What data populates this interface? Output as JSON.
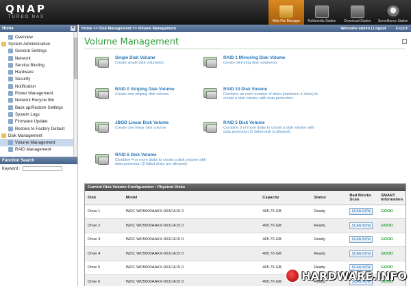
{
  "header": {
    "brand": "QNAP",
    "model": "TURBO NAS",
    "nav": [
      {
        "label": "Web File Manager",
        "icon": "folder-icon"
      },
      {
        "label": "Multimedia Station",
        "icon": "multimedia-icon"
      },
      {
        "label": "Download Station",
        "icon": "download-icon"
      },
      {
        "label": "Surveillance Station",
        "icon": "camera-icon"
      }
    ]
  },
  "sidebar": {
    "title": "Home",
    "close": "×",
    "items": [
      {
        "label": "Overview",
        "level": 2
      },
      {
        "label": "System Administration",
        "level": 1
      },
      {
        "label": "General Settings",
        "level": 2
      },
      {
        "label": "Network",
        "level": 2
      },
      {
        "label": "Service Binding",
        "level": 2
      },
      {
        "label": "Hardware",
        "level": 2
      },
      {
        "label": "Security",
        "level": 2
      },
      {
        "label": "Notification",
        "level": 2
      },
      {
        "label": "Power Management",
        "level": 2
      },
      {
        "label": "Network Recycle Bin",
        "level": 2
      },
      {
        "label": "Back up/Restore Settings",
        "level": 2
      },
      {
        "label": "System Logs",
        "level": 2
      },
      {
        "label": "Firmware Update",
        "level": 2
      },
      {
        "label": "Restore to Factory Default",
        "level": 2
      },
      {
        "label": "Disk Management",
        "level": 1
      },
      {
        "label": "Volume Management",
        "level": 2,
        "selected": true
      },
      {
        "label": "RAID Management",
        "level": 2
      }
    ],
    "function_search": {
      "title": "Function Search",
      "keyword_label": "Keyword :",
      "value": ""
    }
  },
  "breadcrumb": {
    "path": "Home >> Disk Management >> Volume Management",
    "welcome": "Welcome admin | Logout",
    "language": "English"
  },
  "main": {
    "title": "Volume Management",
    "volumes": [
      {
        "name": "Single Disk Volume",
        "desc": "Create single disk volume(s)."
      },
      {
        "name": "RAID 1 Mirroring Disk Volume",
        "desc": "Create mirroring disk volume(s)."
      },
      {
        "name": "RAID 0 Striping Disk Volume",
        "desc": "Create one striping disk volume."
      },
      {
        "name": "RAID 10 Disk Volume",
        "desc": "Combine an even number of disks (minimum 4 disks) to create a disk volume with data protection."
      },
      {
        "name": "JBOD Linear Disk Volume",
        "desc": "Create one linear disk volume."
      },
      {
        "name": "RAID 5 Disk Volume",
        "desc": "Combine 3 or more disks to create a disk volume with data protection (1 failed disk is allowed)."
      },
      {
        "name": "RAID 6 Disk Volume",
        "desc": "Combine 4 or more disks to create a disk volume with data protection (2 failed disks are allowed)."
      }
    ],
    "table": {
      "caption": "Current Disk Volume Configuration : Physical Disks",
      "headers": [
        "Disk",
        "Model",
        "Capacity",
        "Status",
        "Bad Blocks Scan",
        "SMART Information"
      ],
      "rows": [
        {
          "disk": "Drive 1",
          "model": "WDC WD5000AAKX-003CA15.0",
          "capacity": "465.76 GB",
          "status": "Ready",
          "scan": "SCAN NOW",
          "smart": "GOOD"
        },
        {
          "disk": "Drive 2",
          "model": "WDC WD5000AAKX-001CA15.0",
          "capacity": "465.76 GB",
          "status": "Ready",
          "scan": "SCAN NOW",
          "smart": "GOOD"
        },
        {
          "disk": "Drive 3",
          "model": "WDC WD5000AAKX-001CA15.0",
          "capacity": "465.76 GB",
          "status": "Ready",
          "scan": "SCAN NOW",
          "smart": "GOOD"
        },
        {
          "disk": "Drive 4",
          "model": "WDC WD5000AAKX-001CA15.0",
          "capacity": "465.76 GB",
          "status": "Ready",
          "scan": "SCAN NOW",
          "smart": "GOOD"
        },
        {
          "disk": "Drive 5",
          "model": "WDC WD5000AAKX-001CA15.0",
          "capacity": "465.76 GB",
          "status": "Ready",
          "scan": "SCAN NOW",
          "smart": "GOOD"
        },
        {
          "disk": "Drive 6",
          "model": "WDC WD5000AAKX-001CA15.0",
          "capacity": "465.76 GB",
          "status": "Ready",
          "scan": "SCAN NOW",
          "smart": "GOOD"
        }
      ]
    }
  },
  "watermark": {
    "text": "HARDWARE.INFO"
  },
  "colors": {
    "accent_green": "#2e9c3c",
    "link_blue": "#1f73b7",
    "header_blue": "#46628a",
    "active_orange": "#d98a22"
  }
}
